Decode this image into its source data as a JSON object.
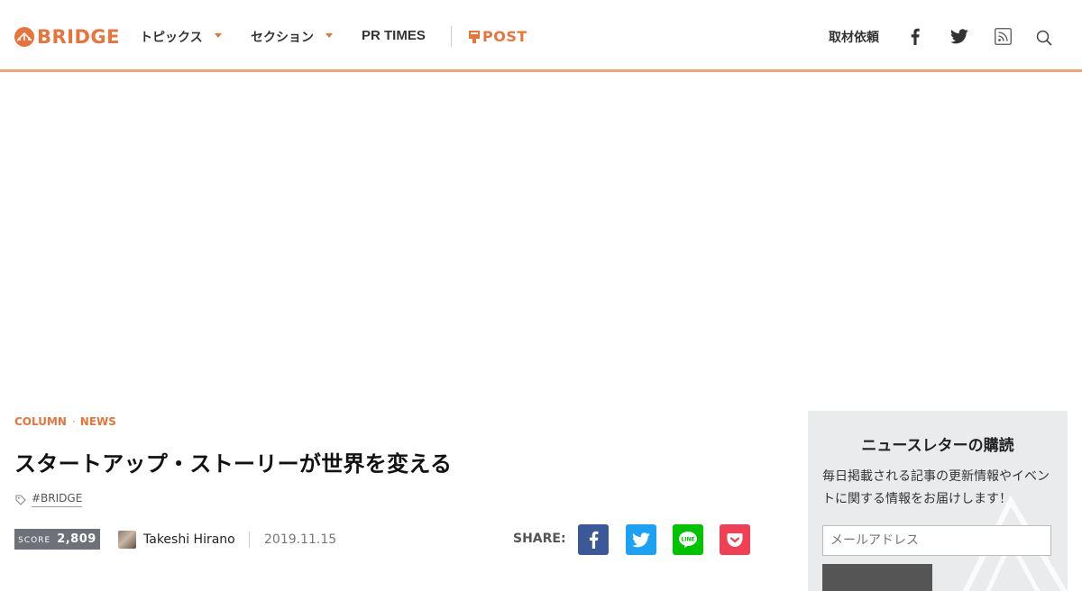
{
  "header": {
    "logo_text": "BRIDGE",
    "nav": [
      {
        "label": "トピックス",
        "has_dropdown": true
      },
      {
        "label": "セクション",
        "has_dropdown": true
      },
      {
        "label": "PR TIMES",
        "has_dropdown": false
      }
    ],
    "post_label": "POST",
    "request_label": "取材依頼",
    "icons": [
      "facebook-icon",
      "twitter-icon",
      "rss-icon",
      "search-icon"
    ]
  },
  "article": {
    "categories": [
      "COLUMN",
      "NEWS"
    ],
    "category_separator": "·",
    "title": "スタートアップ・ストーリーが世界を変える",
    "tag": "#BRIDGE",
    "score_label": "SCORE",
    "score_value": "2,809",
    "author": "Takeshi Hirano",
    "date": "2019.11.15",
    "share_label": "SHARE:",
    "share_buttons": [
      {
        "name": "facebook",
        "color": "#3b5998"
      },
      {
        "name": "twitter",
        "color": "#1da1f2"
      },
      {
        "name": "line",
        "color": "#00c300"
      },
      {
        "name": "pocket",
        "color": "#ef4056"
      }
    ]
  },
  "newsletter": {
    "title": "ニュースレターの購読",
    "description": "毎日掲載される記事の更新情報やイベントに関する情報をお届けします！",
    "email_placeholder": "メールアドレス"
  },
  "colors": {
    "accent": "#e8743b",
    "header_border": "#f0a272",
    "sidebar_bg": "#eaebed",
    "score_bg": "#6e7278"
  }
}
